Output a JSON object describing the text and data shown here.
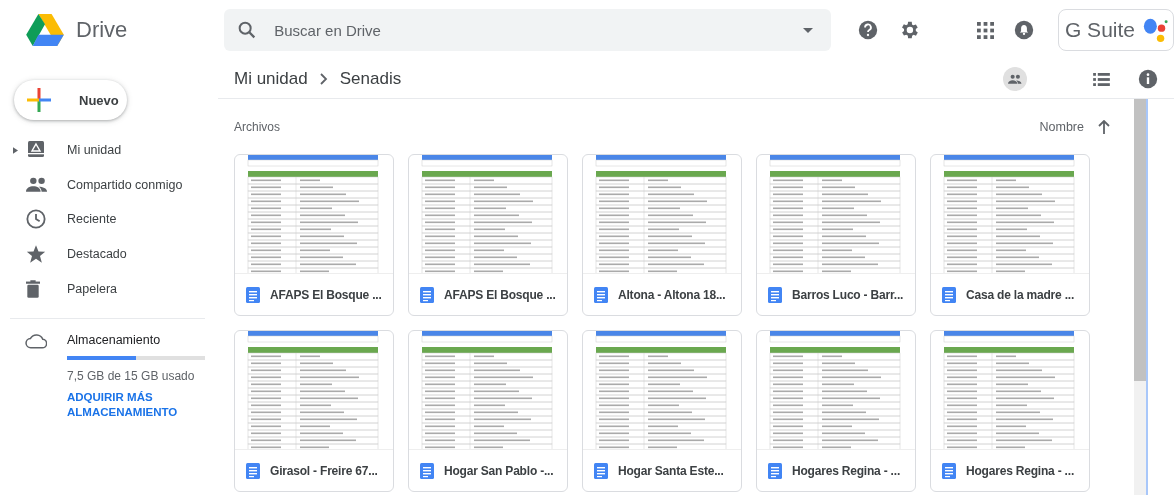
{
  "app": {
    "name": "Drive",
    "suite_label": "G Suite"
  },
  "search": {
    "placeholder": "Buscar en Drive"
  },
  "new_button": {
    "label": "Nuevo"
  },
  "sidebar": {
    "items": [
      {
        "label": "Mi unidad",
        "kind": "drive",
        "selected": false,
        "expanded": false
      },
      {
        "label": "Compartido conmigo",
        "kind": "people",
        "selected": false
      },
      {
        "label": "Reciente",
        "kind": "clock",
        "selected": false
      },
      {
        "label": "Destacado",
        "kind": "star",
        "selected": false
      },
      {
        "label": "Papelera",
        "kind": "trash",
        "selected": false
      }
    ]
  },
  "storage": {
    "title": "Almacenamiento",
    "level": 0.5,
    "usage": "7,5 GB de 15 GB usado",
    "link": "ADQUIRIR MÁS ALMACENAMIENTO"
  },
  "breadcrumb": [
    "Mi unidad",
    "Senadis"
  ],
  "section_title": "Archivos",
  "sort": {
    "label": "Nombre",
    "ascending": true
  },
  "files": [
    {
      "name": "AFAPS El Bosque ..."
    },
    {
      "name": "AFAPS El Bosque ..."
    },
    {
      "name": "Altona - Altona 18..."
    },
    {
      "name": "Barros Luco - Barr..."
    },
    {
      "name": "Casa de la madre ..."
    },
    {
      "name": "Girasol - Freire 67..."
    },
    {
      "name": "Hogar San Pablo -..."
    },
    {
      "name": "Hogar Santa Este..."
    },
    {
      "name": "Hogares Regina - ..."
    },
    {
      "name": "Hogares Regina - ..."
    }
  ]
}
